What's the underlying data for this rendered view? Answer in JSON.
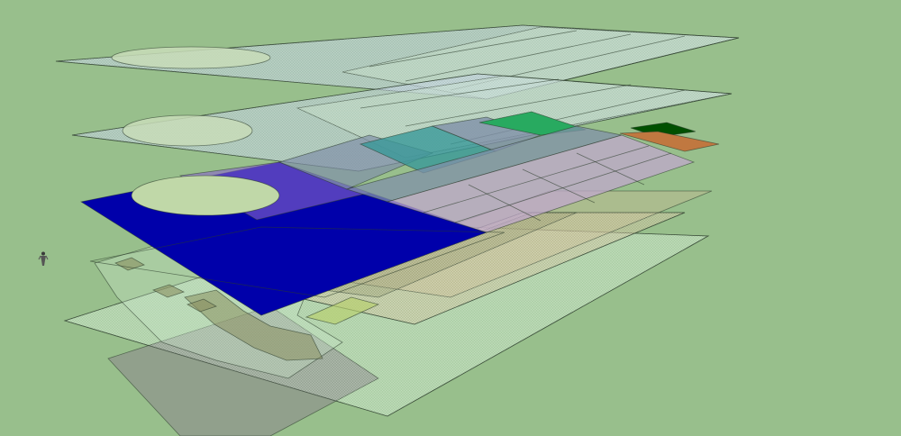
{
  "viewport": {
    "background": "#98bf8c",
    "view_mode": "perspective",
    "style": "x-ray"
  },
  "colors": {
    "sky_plane": "#b8c8d8",
    "glass": "#c8e4c8",
    "blue_slab": "#0000aa",
    "purple_zone": "#8866cc",
    "teal": "#3a9898",
    "slate": "#8090a8",
    "lavender": "#c0a8cc",
    "green_block": "#28aa60",
    "dark_green": "#005000",
    "orange": "#c07840",
    "tan": "#c8b890",
    "olive": "#8a9060",
    "gray_pad": "#8c8c8c",
    "edge": "#2a3a2a"
  },
  "icons": {
    "scale_figure": "person-icon"
  }
}
